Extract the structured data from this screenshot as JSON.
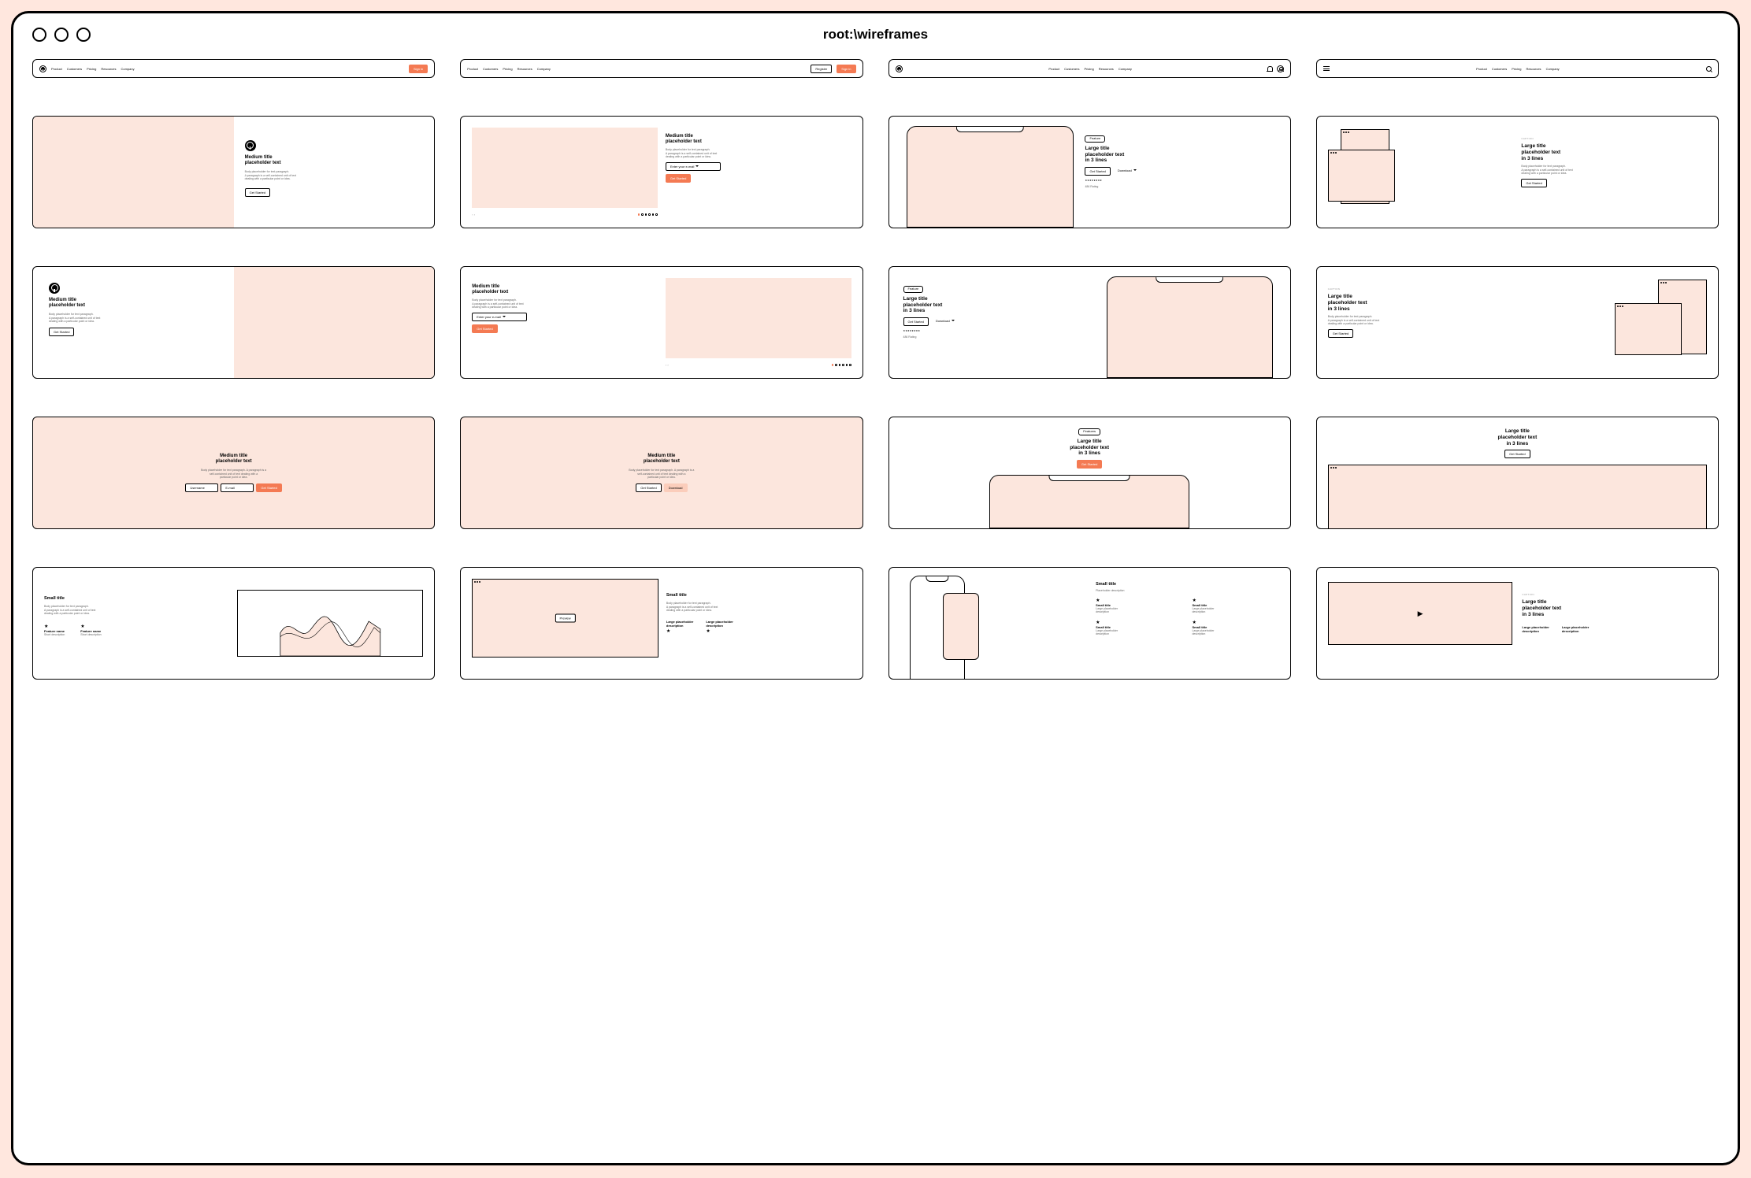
{
  "window_title": "root:\\wireframes",
  "nav": {
    "items": [
      "Product",
      "Customers",
      "Pricing",
      "Resources",
      "Company"
    ],
    "signin": "Sign in",
    "register": "Register"
  },
  "common": {
    "caption": "CAPTION",
    "medium_title_l1": "Medium title",
    "medium_title_l2": "placeholder text",
    "large_title_l1": "Large title",
    "large_title_l2": "placeholder text",
    "large_title_l3": "in 3 lines",
    "small_title": "Small title",
    "body_l1": "Body placeholder for text paragraph.",
    "body_l2": "A paragraph is a self-contained unit of text",
    "body_l3": "dealing with a particular point or idea.",
    "body_alt_l1": "Body placeholder for text paragraph. A paragraph is a",
    "body_alt_l2": "self-contained unit of text dealing with a",
    "body_alt_l3": "particular point or idea.",
    "get_started": "Get Started",
    "download": "Download",
    "preview": "Preview",
    "feature_pill": "Feature",
    "features_pill": "Features",
    "email_ph": "Enter your e-mail",
    "username_ph": "Username",
    "email_short_ph": "E-mail",
    "rating": "486 Rating",
    "feature_name": "Feature name",
    "short_desc": "Short description",
    "large_placeholder": "Large placeholder",
    "description": "description",
    "placeholder_description": "Placeholder description"
  }
}
